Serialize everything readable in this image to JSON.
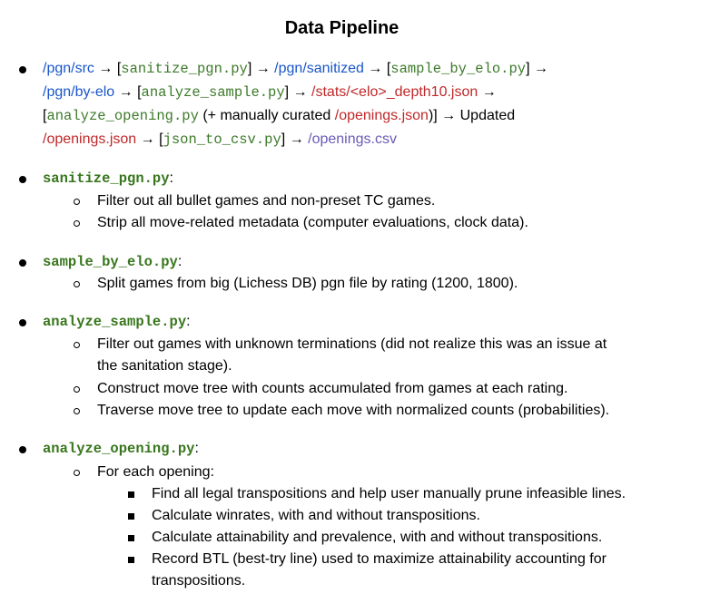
{
  "title": "Data Pipeline",
  "colors": {
    "path_blue": "#1a56c9",
    "path_red": "#c0282a",
    "script_green": "#3d7a2a",
    "csv_purple": "#6a5bb8",
    "heading_green": "#38761d"
  },
  "pipeline": {
    "src": "/pgn/src",
    "arrow": "→",
    "lb": "[",
    "rb": "]",
    "sanitize": "sanitize_pgn.py",
    "sanitized": "/pgn/sanitized",
    "sample": "sample_by_elo.py",
    "by_elo": "/pgn/by-elo",
    "analyze_sample": "analyze_sample.py",
    "stats": "/stats/<elo>_depth10.json",
    "analyze_opening": "analyze_opening.py",
    "curated_prefix": " (+ manually curated ",
    "openings_json": "/openings.json",
    "close_paren": ")",
    "updated": " Updated",
    "openings_json2": "/openings.json",
    "json_to_csv": "json_to_csv.py",
    "openings_csv": "/openings.csv"
  },
  "sections": [
    {
      "name": "sanitize_pgn.py",
      "colon": ":",
      "items": [
        "Filter out all bullet games and non-preset TC games.",
        "Strip all move-related metadata (computer evaluations, clock data)."
      ]
    },
    {
      "name": "sample_by_elo.py",
      "colon": ":",
      "items": [
        "Split games from big (Lichess DB) pgn file by rating (1200, 1800)."
      ]
    },
    {
      "name": "analyze_sample.py",
      "colon": ":",
      "items": [
        "Filter out games with unknown terminations (did not realize this was an issue at",
        "the sanitation stage).",
        "Construct move tree with counts accumulated from games at each rating.",
        "Traverse move tree to update each move with normalized counts (probabilities)."
      ]
    },
    {
      "name": "analyze_opening.py",
      "colon": ":",
      "items": [
        "For each opening:"
      ],
      "subitems": [
        "Find all legal transpositions and help user manually prune infeasible lines.",
        "Calculate winrates, with and without transpositions.",
        "Calculate attainability and prevalence, with and without transpositions.",
        "Record BTL (best-try line) used to maximize attainability accounting for",
        "transpositions."
      ]
    }
  ]
}
